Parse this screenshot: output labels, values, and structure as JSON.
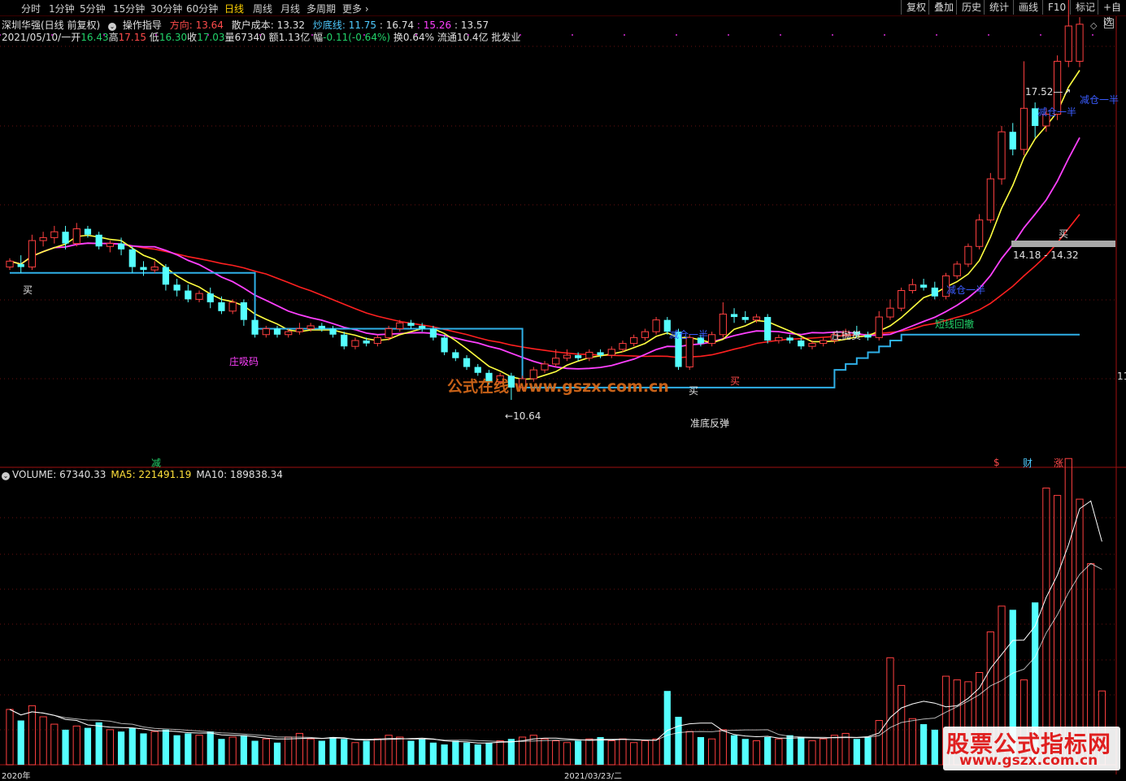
{
  "toolbar": {
    "timeframes": [
      "分时",
      "1分钟",
      "5分钟",
      "15分钟",
      "30分钟",
      "60分钟",
      "日线",
      "周线",
      "月线",
      "多周期",
      "更多"
    ],
    "active": "日线",
    "right_buttons": [
      "复权",
      "叠加",
      "历史",
      "统计",
      "画线",
      "F10",
      "标记",
      "+自选"
    ]
  },
  "header": {
    "stock": "深圳华强(日线 前复权)",
    "indicator": "操作指导",
    "direction_label": "方向:",
    "direction_value": "13.64",
    "retail_cost_label": "散户成本:",
    "retail_cost_value": "13.32",
    "bottom_line_label": "炒底线:",
    "bottom_line_value": "11.75",
    "v1": ": 16.74",
    "v2": ": 15.26",
    "v3": ": 13.57"
  },
  "quote": {
    "date": "2021/05/10/一",
    "open_label": "开",
    "open": "16.43",
    "high_label": "高",
    "high": "17.15",
    "low_label": "低",
    "low": "16.30",
    "close_label": "收",
    "close": "17.03",
    "vol_label": "量",
    "vol": "67340",
    "amt_label": "额",
    "amt": "1.13亿",
    "chg_label": "幅",
    "chg": "-0.11(-0.64%)",
    "turn": "换0.64%",
    "float": "流通10.4亿",
    "industry": "批发业"
  },
  "volume_header": {
    "label": "VOLUME: 67340.33",
    "ma5": "MA5: 221491.19",
    "ma10": "MA10: 189838.34"
  },
  "annotations": {
    "buy": "买",
    "absorb": "庄吸码",
    "high_price": "17.52",
    "low_price": "10.64",
    "reduce": "减仓一半",
    "short_pullback": "短线回撤",
    "dump": "庄抛货",
    "near_bottom": "准底反弹",
    "range": "14.18 - 14.32",
    "reduce_marker": "减",
    "s_marker": "$",
    "fin_marker": "财",
    "limit_marker": "涨",
    "axis_right": "11",
    "date_axis": "2021/03/23/二",
    "date_left": "2020年"
  },
  "watermarks": {
    "center": "公式在线 www.gszx.com.cn",
    "corner_title": "股票公式指标网",
    "corner_url": "www.gszx.com.cn"
  },
  "colors": {
    "up": "#ff4040",
    "down": "#55ffff",
    "ma_short": "#ffff40",
    "ma_mid": "#ff40ff",
    "ma_long": "#ff2020",
    "support": "#2fb0e8"
  },
  "chart_data": {
    "type": "candlestick",
    "price_axis_visible_tick": 11,
    "high_mark": 17.52,
    "low_mark": 10.64,
    "candles": [
      [
        12.9,
        13.0,
        12.85,
        13.05
      ],
      [
        12.95,
        12.9,
        12.8,
        13.1
      ],
      [
        12.9,
        13.35,
        12.85,
        13.45
      ],
      [
        13.35,
        13.4,
        13.25,
        13.5
      ],
      [
        13.4,
        13.5,
        13.3,
        13.6
      ],
      [
        13.5,
        13.3,
        13.2,
        13.6
      ],
      [
        13.3,
        13.55,
        13.25,
        13.65
      ],
      [
        13.55,
        13.45,
        13.4,
        13.6
      ],
      [
        13.45,
        13.25,
        13.2,
        13.5
      ],
      [
        13.25,
        13.3,
        13.15,
        13.35
      ],
      [
        13.3,
        13.2,
        13.1,
        13.4
      ],
      [
        13.2,
        12.9,
        12.8,
        13.25
      ],
      [
        12.9,
        12.85,
        12.75,
        13.0
      ],
      [
        12.85,
        12.9,
        12.8,
        13.0
      ],
      [
        12.9,
        12.6,
        12.5,
        12.95
      ],
      [
        12.6,
        12.5,
        12.4,
        12.7
      ],
      [
        12.5,
        12.35,
        12.3,
        12.6
      ],
      [
        12.35,
        12.45,
        12.3,
        12.5
      ],
      [
        12.45,
        12.3,
        12.2,
        12.55
      ],
      [
        12.3,
        12.15,
        12.1,
        12.4
      ],
      [
        12.15,
        12.3,
        12.1,
        12.35
      ],
      [
        12.3,
        12.0,
        11.9,
        12.35
      ],
      [
        12.0,
        11.75,
        11.7,
        12.05
      ],
      [
        11.75,
        11.85,
        11.7,
        11.9
      ],
      [
        11.85,
        11.75,
        11.7,
        11.9
      ],
      [
        11.75,
        11.8,
        11.7,
        11.85
      ],
      [
        11.8,
        11.85,
        11.75,
        11.95
      ],
      [
        11.85,
        11.9,
        11.8,
        11.95
      ],
      [
        11.9,
        11.85,
        11.8,
        11.95
      ],
      [
        11.85,
        11.75,
        11.7,
        11.9
      ],
      [
        11.75,
        11.55,
        11.5,
        11.8
      ],
      [
        11.55,
        11.65,
        11.5,
        11.7
      ],
      [
        11.65,
        11.6,
        11.55,
        11.7
      ],
      [
        11.6,
        11.7,
        11.55,
        11.75
      ],
      [
        11.7,
        11.85,
        11.65,
        11.9
      ],
      [
        11.85,
        11.95,
        11.8,
        12.0
      ],
      [
        11.95,
        11.9,
        11.85,
        12.0
      ],
      [
        11.9,
        11.85,
        11.8,
        11.95
      ],
      [
        11.85,
        11.7,
        11.65,
        11.9
      ],
      [
        11.7,
        11.45,
        11.4,
        11.75
      ],
      [
        11.45,
        11.35,
        11.3,
        11.5
      ],
      [
        11.35,
        11.2,
        11.15,
        11.4
      ],
      [
        11.2,
        11.1,
        11.05,
        11.25
      ],
      [
        11.1,
        10.95,
        10.9,
        11.15
      ],
      [
        10.95,
        11.05,
        10.9,
        11.1
      ],
      [
        11.05,
        10.85,
        10.64,
        11.1
      ],
      [
        10.85,
        11.0,
        10.8,
        11.05
      ],
      [
        11.0,
        11.15,
        10.95,
        11.2
      ],
      [
        11.15,
        11.25,
        11.1,
        11.3
      ],
      [
        11.25,
        11.35,
        11.2,
        11.5
      ],
      [
        11.35,
        11.4,
        11.3,
        11.5
      ],
      [
        11.4,
        11.35,
        11.3,
        11.45
      ],
      [
        11.35,
        11.45,
        11.3,
        11.5
      ],
      [
        11.45,
        11.4,
        11.35,
        11.5
      ],
      [
        11.4,
        11.5,
        11.35,
        11.55
      ],
      [
        11.5,
        11.6,
        11.45,
        11.65
      ],
      [
        11.6,
        11.7,
        11.55,
        11.75
      ],
      [
        11.7,
        11.8,
        11.65,
        11.85
      ],
      [
        11.8,
        12.0,
        11.75,
        12.05
      ],
      [
        12.0,
        11.8,
        11.75,
        12.05
      ],
      [
        11.8,
        11.2,
        11.15,
        11.85
      ],
      [
        11.2,
        11.7,
        11.15,
        11.75
      ],
      [
        11.7,
        11.6,
        11.55,
        11.75
      ],
      [
        11.6,
        11.75,
        11.55,
        11.8
      ],
      [
        11.75,
        12.1,
        11.7,
        12.3
      ],
      [
        12.1,
        12.05,
        11.95,
        12.2
      ],
      [
        12.05,
        12.0,
        11.95,
        12.15
      ],
      [
        12.0,
        12.05,
        11.95,
        12.1
      ],
      [
        12.05,
        11.65,
        11.6,
        12.1
      ],
      [
        11.65,
        11.7,
        11.6,
        11.75
      ],
      [
        11.7,
        11.65,
        11.6,
        11.75
      ],
      [
        11.65,
        11.55,
        11.5,
        11.7
      ],
      [
        11.55,
        11.6,
        11.5,
        11.65
      ],
      [
        11.6,
        11.65,
        11.55,
        11.7
      ],
      [
        11.65,
        11.75,
        11.6,
        11.8
      ],
      [
        11.75,
        11.8,
        11.7,
        11.85
      ],
      [
        11.8,
        11.75,
        11.7,
        11.9
      ],
      [
        11.75,
        11.7,
        11.65,
        11.8
      ],
      [
        11.7,
        12.05,
        11.65,
        12.15
      ],
      [
        12.05,
        12.2,
        12.0,
        12.35
      ],
      [
        12.2,
        12.5,
        12.15,
        12.55
      ],
      [
        12.5,
        12.6,
        12.45,
        12.7
      ],
      [
        12.6,
        12.55,
        12.5,
        12.7
      ],
      [
        12.55,
        12.4,
        12.35,
        12.65
      ],
      [
        12.4,
        12.75,
        12.35,
        12.8
      ],
      [
        12.75,
        12.95,
        12.7,
        13.0
      ],
      [
        12.95,
        13.25,
        12.9,
        13.3
      ],
      [
        13.25,
        13.7,
        13.2,
        13.8
      ],
      [
        13.7,
        14.4,
        13.65,
        14.5
      ],
      [
        14.4,
        15.2,
        14.3,
        15.3
      ],
      [
        15.2,
        14.9,
        14.8,
        15.35
      ],
      [
        14.9,
        15.6,
        14.8,
        16.4
      ],
      [
        15.6,
        15.3,
        15.1,
        15.7
      ],
      [
        15.3,
        15.5,
        15.2,
        15.6
      ],
      [
        15.5,
        16.4,
        15.4,
        16.5
      ],
      [
        16.4,
        17.0,
        16.3,
        17.52
      ],
      [
        16.4,
        17.03,
        16.3,
        17.15
      ]
    ],
    "volume": [
      150,
      120,
      160,
      130,
      110,
      95,
      105,
      100,
      115,
      95,
      90,
      100,
      85,
      90,
      95,
      80,
      85,
      80,
      90,
      70,
      75,
      80,
      65,
      70,
      60,
      75,
      85,
      70,
      65,
      75,
      70,
      60,
      65,
      70,
      80,
      75,
      65,
      70,
      60,
      55,
      65,
      60,
      55,
      60,
      65,
      70,
      75,
      80,
      70,
      65,
      60,
      65,
      70,
      75,
      65,
      70,
      60,
      65,
      70,
      200,
      130,
      90,
      75,
      70,
      95,
      80,
      70,
      65,
      75,
      70,
      80,
      75,
      65,
      70,
      80,
      85,
      70,
      75,
      120,
      290,
      215,
      125,
      110,
      95,
      240,
      230,
      225,
      250,
      360,
      430,
      420,
      230,
      440,
      750,
      730,
      830,
      720,
      545,
      200
    ]
  }
}
